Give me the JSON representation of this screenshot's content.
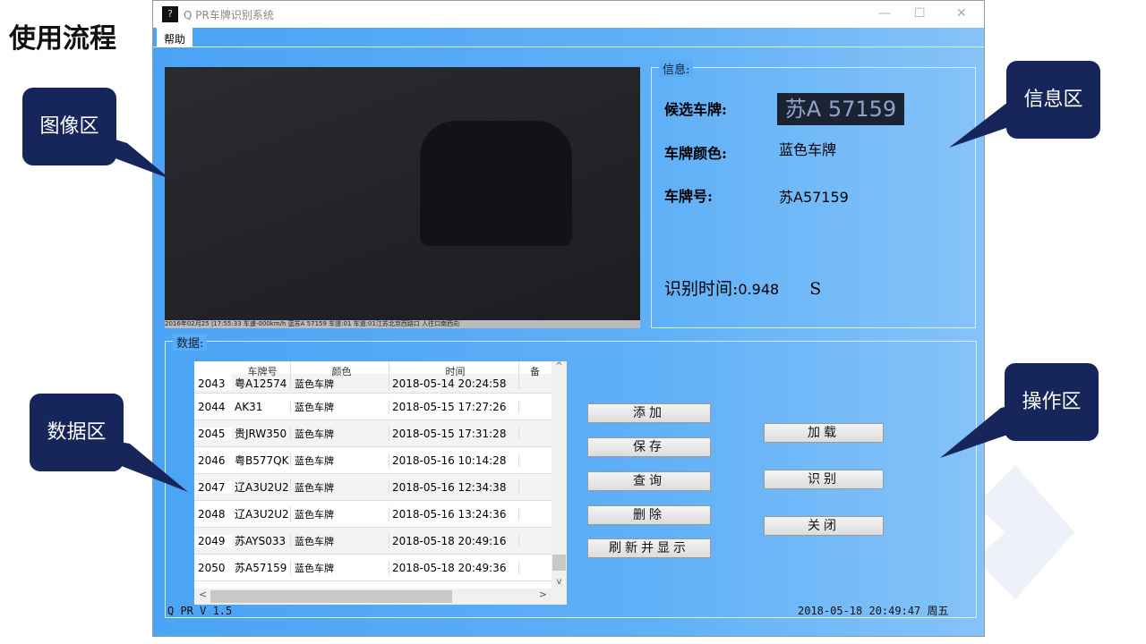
{
  "slide": {
    "title": "使用流程"
  },
  "window": {
    "title": "Q PR车牌识别系统",
    "menu": [
      "帮助"
    ]
  },
  "info": {
    "group_title": "信息:",
    "candidate_label": "候选车牌:",
    "plate_image_text": "苏A 57159",
    "color_label": "车牌颜色:",
    "color_value": "蓝色车牌",
    "number_label": "车牌号:",
    "number_value": "苏A57159",
    "time_label": "识别时间:",
    "time_value": "0.948",
    "time_unit": "S"
  },
  "image": {
    "caption": "2016年02月25 |17:55:33 车速-000km/h 蓝苏A 57159   车道:01 车道:01江苏北京西路口 人往口南西向"
  },
  "data": {
    "group_title": "数据:",
    "columns": [
      "",
      "车牌号",
      "颜色",
      "时间",
      "备"
    ],
    "rows": [
      [
        "2043",
        "粤A12574",
        "蓝色车牌",
        "2018-05-14 20:24:58"
      ],
      [
        "2044",
        "AK31",
        "蓝色车牌",
        "2018-05-15 17:27:26"
      ],
      [
        "2045",
        "贵JRW350",
        "蓝色车牌",
        "2018-05-15 17:31:28"
      ],
      [
        "2046",
        "粤B577QK",
        "蓝色车牌",
        "2018-05-16 10:14:28"
      ],
      [
        "2047",
        "辽A3U2U2",
        "蓝色车牌",
        "2018-05-16 12:34:38"
      ],
      [
        "2048",
        "辽A3U2U2",
        "蓝色车牌",
        "2018-05-16 13:24:36"
      ],
      [
        "2049",
        "苏AYS033",
        "蓝色车牌",
        "2018-05-18 20:49:16"
      ],
      [
        "2050",
        "苏A57159",
        "蓝色车牌",
        "2018-05-18 20:49:36"
      ]
    ]
  },
  "buttons": {
    "add": "添加",
    "save": "保存",
    "query": "查询",
    "delete": "删除",
    "refresh": "刷新并显示",
    "load": "加载",
    "recognize": "识别",
    "close": "关闭"
  },
  "footer": {
    "version": "Q PR V 1.5",
    "datetime": "2018-05-18 20:49:47 周五"
  },
  "callouts": {
    "image": "图像区",
    "info": "信息区",
    "data": "数据区",
    "ops": "操作区"
  }
}
